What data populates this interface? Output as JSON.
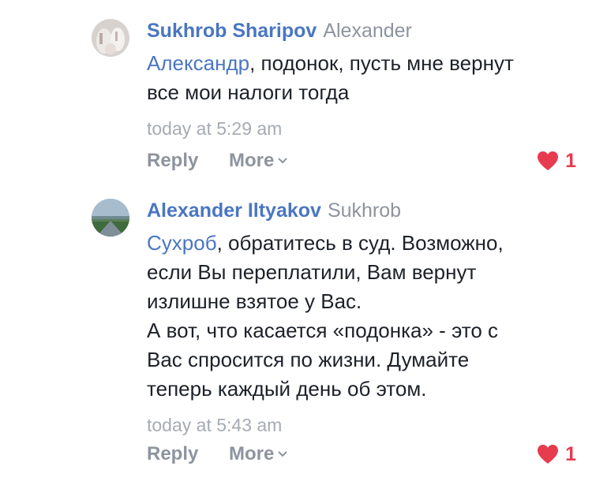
{
  "comments": [
    {
      "author": "Sukhrob Sharipov",
      "reply_to": "Alexander",
      "mention": "Александр",
      "text": ", подонок, пусть мне вернут\nвсе мои налоги тогда",
      "timestamp": "today at 5:29 am",
      "reply_label": "Reply",
      "more_label": "More",
      "reaction_icon": "heart-icon",
      "reaction_count": "1"
    },
    {
      "author": "Alexander Iltyakov",
      "reply_to": "Sukhrob",
      "mention": "Сухроб",
      "text": ", обратитесь в суд. Возможно,\nесли Вы переплатили, Вам вернут\nизлишне взятое у Вас.\nА вот, что касается «подонка» - это с\nВас спросится по жизни. Думайте\nтеперь каждый день об этом.",
      "timestamp": "today at 5:43 am",
      "reply_label": "Reply",
      "more_label": "More",
      "reaction_icon": "heart-icon",
      "reaction_count": "1"
    }
  ],
  "colors": {
    "link": "#4a76c2",
    "meta": "#8d949e",
    "heart": "#e73b4f"
  }
}
